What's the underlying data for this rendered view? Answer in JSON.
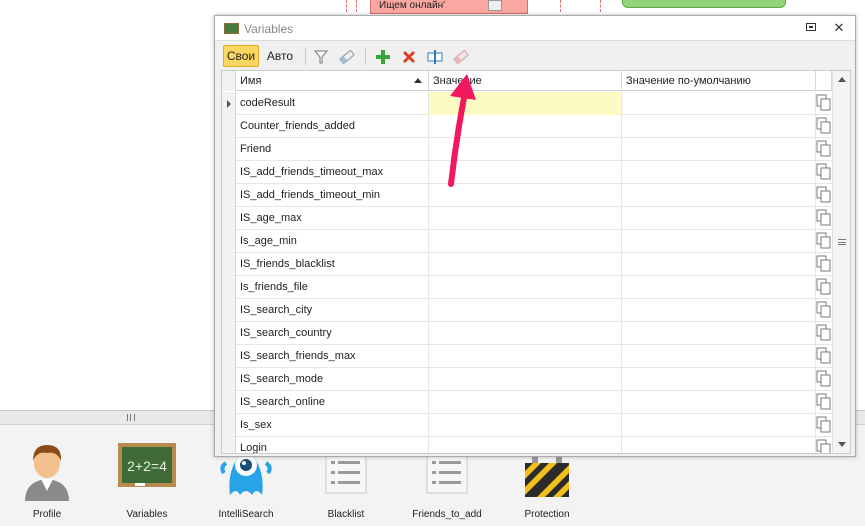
{
  "background": {
    "node_label": "Ищем онлайн'"
  },
  "window": {
    "title": "Variables",
    "title_icon": "chalkboard-icon",
    "minimize_icon": "restore-icon",
    "close_icon": "close-icon"
  },
  "toolbar": {
    "own_label": "Свои",
    "auto_label": "Авто",
    "icons": [
      "filter-icon",
      "eraser-icon",
      "add-icon",
      "delete-icon",
      "rename-icon",
      "clear-icon"
    ]
  },
  "table": {
    "columns": {
      "name": "Имя",
      "value": "Значение",
      "default": "Значение по-умолчанию"
    },
    "rows": [
      {
        "name": "codeResult",
        "value": "",
        "default": ""
      },
      {
        "name": "Counter_friends_added",
        "value": "",
        "default": ""
      },
      {
        "name": "Friend",
        "value": "",
        "default": ""
      },
      {
        "name": "IS_add_friends_timeout_max",
        "value": "",
        "default": ""
      },
      {
        "name": "IS_add_friends_timeout_min",
        "value": "",
        "default": ""
      },
      {
        "name": "IS_age_max",
        "value": "",
        "default": ""
      },
      {
        "name": "Is_age_min",
        "value": "",
        "default": ""
      },
      {
        "name": "IS_friends_blacklist",
        "value": "",
        "default": ""
      },
      {
        "name": "Is_friends_file",
        "value": "",
        "default": ""
      },
      {
        "name": "IS_search_city",
        "value": "",
        "default": ""
      },
      {
        "name": "IS_search_country",
        "value": "",
        "default": ""
      },
      {
        "name": "IS_search_friends_max",
        "value": "",
        "default": ""
      },
      {
        "name": "IS_search_mode",
        "value": "",
        "default": ""
      },
      {
        "name": "IS_search_online",
        "value": "",
        "default": ""
      },
      {
        "name": "Is_sex",
        "value": "",
        "default": ""
      },
      {
        "name": "Login",
        "value": "",
        "default": ""
      }
    ],
    "selected_row": 0,
    "selected_cell_color": "#fdfbc4"
  },
  "dock": {
    "items": [
      {
        "label": "Profile",
        "icon": "user-avatar-icon"
      },
      {
        "label": "Variables",
        "icon": "chalkboard-icon",
        "board_text": "2+2=4"
      },
      {
        "label": "IntelliSearch",
        "icon": "blue-monster-icon"
      },
      {
        "label": "Blacklist",
        "icon": "list-document-icon"
      },
      {
        "label": "Friends_to_add",
        "icon": "list-document-icon"
      },
      {
        "label": "Protection",
        "icon": "padlock-icon"
      }
    ]
  },
  "annotation": {
    "arrow_color": "#f2185e"
  }
}
